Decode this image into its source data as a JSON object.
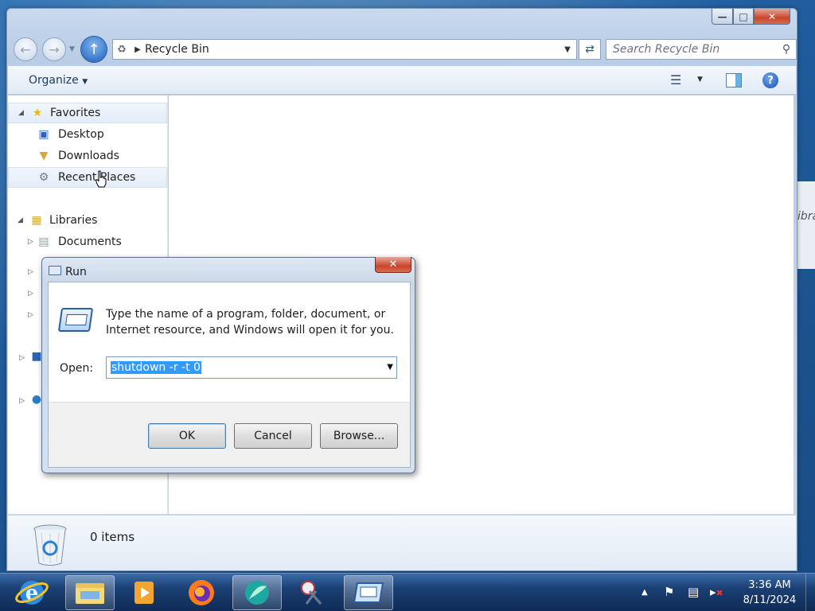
{
  "explorer": {
    "address_path": "Recycle Bin",
    "search_placeholder": "Search Recycle Bin",
    "organize_label": "Organize",
    "nav": {
      "favorites": "Favorites",
      "desktop": "Desktop",
      "downloads": "Downloads",
      "recent_places": "Recent Places",
      "libraries": "Libraries",
      "documents": "Documents"
    },
    "status_count": "0 items"
  },
  "background_window": {
    "text": "ibra"
  },
  "run_dialog": {
    "title": "Run",
    "description": "Type the name of a program, folder, document, or Internet resource, and Windows will open it for you.",
    "open_label": "Open:",
    "open_value": "shutdown -r -t 0",
    "ok_label": "OK",
    "cancel_label": "Cancel",
    "browse_label": "Browse..."
  },
  "taskbar": {
    "apps": [
      "Internet Explorer",
      "Windows Explorer",
      "Media",
      "Firefox",
      "App",
      "Snipping Tool",
      "Run"
    ],
    "time": "3:36 AM",
    "date": "8/11/2024"
  },
  "colors": {
    "selection": "#3399ff",
    "taskbar": "#1b3f73",
    "close_red": "#c8452c"
  }
}
